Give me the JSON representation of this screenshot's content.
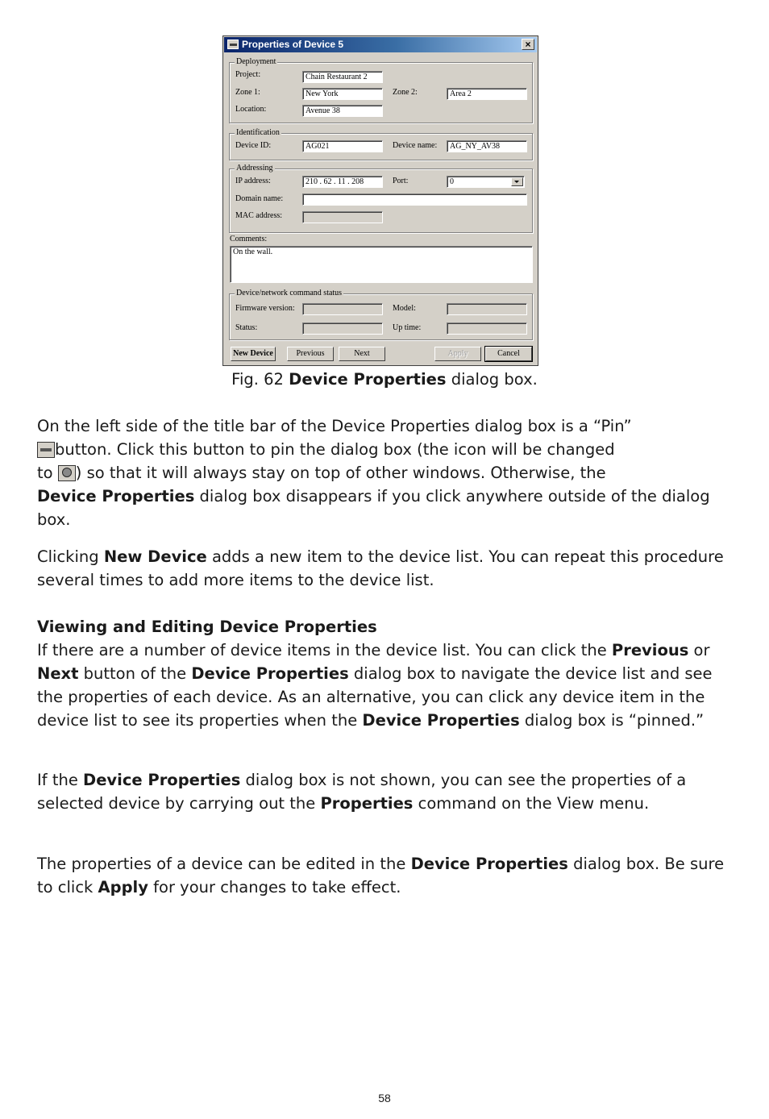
{
  "dialog": {
    "title": "Properties of Device 5",
    "close_label": "×",
    "deployment": {
      "legend": "Deployment",
      "project_label": "Project:",
      "project_value": "Chain Restaurant 2",
      "zone1_label": "Zone 1:",
      "zone1_value": "New York",
      "zone2_label": "Zone 2:",
      "zone2_value": "Area 2",
      "location_label": "Location:",
      "location_value": "Avenue 38"
    },
    "identification": {
      "legend": "Identification",
      "device_id_label": "Device ID:",
      "device_id_value": "AG021",
      "device_name_label": "Device name:",
      "device_name_value": "AG_NY_AV38"
    },
    "addressing": {
      "legend": "Addressing",
      "ip_label": "IP address:",
      "ip_value": "210 . 62 . 11 . 208",
      "port_label": "Port:",
      "port_value": "0",
      "domain_label": "Domain name:",
      "domain_value": "",
      "mac_label": "MAC address:",
      "mac_value": ""
    },
    "comments": {
      "label": "Comments:",
      "value": "On the wall."
    },
    "status": {
      "legend": "Device/network command status",
      "firmware_label": "Firmware version:",
      "model_label": "Model:",
      "status_label": "Status:",
      "uptime_label": "Up time:"
    },
    "buttons": {
      "new_device": "New Device",
      "previous": "Previous",
      "next": "Next",
      "apply": "Apply",
      "cancel": "Cancel"
    }
  },
  "caption": {
    "prefix": "Fig. 62 ",
    "bold": "Device Properties",
    "suffix": " dialog box."
  },
  "paragraphs": {
    "p1": {
      "a": "On the left side of the title bar of the Device Properties dialog box is a “Pin”",
      "b": "button. Click this button to pin the dialog box (the icon will be changed",
      "c": "to ",
      "d": ") so that it will always stay on top of other windows. Otherwise, the",
      "e": "Device Properties",
      "f": " dialog box disappears if you click anywhere outside of the dialog box."
    },
    "p2": {
      "a": "Clicking ",
      "b": "New Device",
      "c": " adds a new item to the device list. You can repeat this procedure several times to add more items to the device list."
    },
    "heading": "Viewing and Editing Device Properties",
    "p3": {
      "a": "If there are a number of device items in the device list. You can click the ",
      "b": "Previous",
      "c": " or ",
      "d": "Next",
      "e": " button of the ",
      "f": "Device Properties",
      "g": " dialog box to navigate the device list and see the properties of each device. As an alternative, you can click any device item in the device list to see its properties when the ",
      "h": "Device Properties",
      "i": " dialog box is “pinned.”"
    },
    "p4": {
      "a": "If the ",
      "b": "Device Properties",
      "c": " dialog box is not shown, you can see the properties of a selected device by carrying out the ",
      "d": "Properties",
      "e": " command on the View menu."
    },
    "p5": {
      "a": "The properties of a device can be edited in the ",
      "b": "Device Properties",
      "c": " dialog box. Be sure to click ",
      "d": "Apply",
      "e": " for your changes to take effect."
    }
  },
  "page_number": "58"
}
